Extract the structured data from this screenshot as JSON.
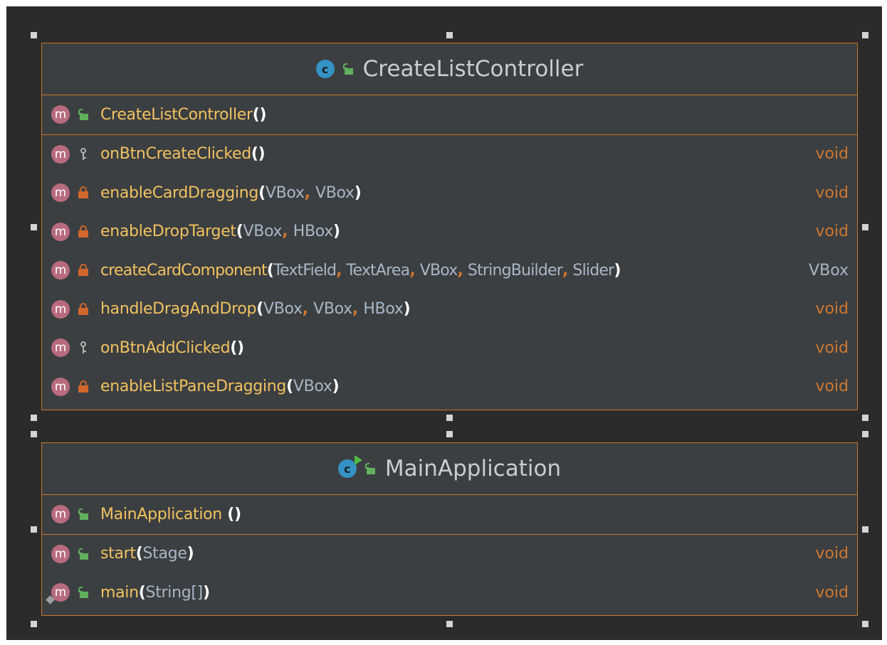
{
  "diagram": {
    "classes": [
      {
        "name": "CreateListController",
        "icon": "class-icon",
        "icon_letter": "c",
        "visibility": "public",
        "constructors": [
          {
            "name": "CreateListController",
            "params": [],
            "visibility": "public"
          }
        ],
        "methods": [
          {
            "name": "onBtnCreateClicked",
            "params": [],
            "returns": "void",
            "visibility": "package"
          },
          {
            "name": "enableCardDragging",
            "params": [
              "VBox",
              "VBox"
            ],
            "returns": "void",
            "visibility": "private"
          },
          {
            "name": "enableDropTarget",
            "params": [
              "VBox",
              "HBox"
            ],
            "returns": "void",
            "visibility": "private"
          },
          {
            "name": "createCardComponent",
            "params": [
              "TextField",
              "TextArea",
              "VBox",
              "StringBuilder",
              "Slider"
            ],
            "returns": "VBox",
            "visibility": "private"
          },
          {
            "name": "handleDragAndDrop",
            "params": [
              "VBox",
              "VBox",
              "HBox"
            ],
            "returns": "void",
            "visibility": "private"
          },
          {
            "name": "onBtnAddClicked",
            "params": [],
            "returns": "void",
            "visibility": "package"
          },
          {
            "name": "enableListPaneDragging",
            "params": [
              "VBox"
            ],
            "returns": "void",
            "visibility": "private"
          }
        ]
      },
      {
        "name": "MainApplication",
        "icon": "runnable-class-icon",
        "icon_letter": "c",
        "visibility": "public",
        "constructors": [
          {
            "name": "MainApplication",
            "params": [],
            "visibility": "public"
          }
        ],
        "methods": [
          {
            "name": "start",
            "params": [
              "Stage"
            ],
            "returns": "void",
            "visibility": "public"
          },
          {
            "name": "main",
            "params": [
              "String[]"
            ],
            "returns": "void",
            "visibility": "public"
          }
        ]
      }
    ],
    "method_icon_letter": "m",
    "colors": {
      "background": "#2b2b2b",
      "box": "#3c3f41",
      "border": "#c7762c",
      "method_name": "#f1c261",
      "param": "#a9b7c6",
      "keyword": "#cc7832",
      "class_icon": "#3592c4",
      "method_icon": "#b86b7e",
      "public": "#60b05e",
      "private": "#d0672c"
    }
  }
}
